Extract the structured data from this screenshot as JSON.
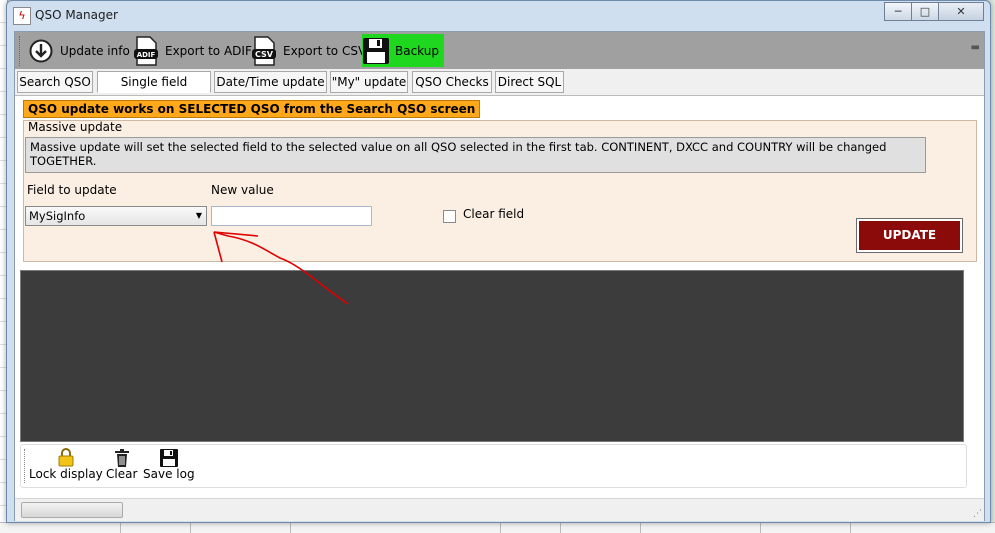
{
  "window": {
    "title": "QSO Manager",
    "minimize": "─",
    "maximize": "□",
    "close": "✕"
  },
  "toolbar": {
    "items": [
      {
        "label": "Update info",
        "icon": "download-icon"
      },
      {
        "label": "Export to ADIF",
        "icon": "adif-file-icon",
        "badge": "ADIF"
      },
      {
        "label": "Export to CSV",
        "icon": "csv-file-icon",
        "badge": "CSV"
      },
      {
        "label": "Backup",
        "icon": "floppy-disk-icon",
        "active": true
      }
    ]
  },
  "tabs": [
    {
      "label": "Search QSO"
    },
    {
      "label": "Single field update",
      "active": true
    },
    {
      "label": "Date/Time update"
    },
    {
      "label": "\"My\" update"
    },
    {
      "label": "QSO Checks"
    },
    {
      "label": "Direct SQL"
    }
  ],
  "notice": "QSO update works on SELECTED QSO from the Search QSO screen",
  "massive": {
    "group_title": "Massive update",
    "description": "Massive update will set the selected field to the selected value on all QSO selected in the first tab. CONTINENT, DXCC and COUNTRY will be changed TOGETHER.",
    "field_label": "Field to update",
    "field_value": "MySigInfo",
    "new_value_label": "New value",
    "new_value": "",
    "clear_label": "Clear field",
    "clear_checked": false,
    "update_button": "UPDATE"
  },
  "bottom_toolbar": {
    "items": [
      {
        "label": "Lock display",
        "icon": "lock-icon"
      },
      {
        "label": "Clear",
        "icon": "trash-icon"
      },
      {
        "label": "Save log",
        "icon": "floppy-disk-icon"
      }
    ]
  },
  "colors": {
    "active_toolbar": "#1fd71f",
    "notice_bg": "#ffa81c",
    "update_button": "#8b0b0b",
    "console_bg": "#3c3c3c",
    "annotation": "#e00000"
  }
}
